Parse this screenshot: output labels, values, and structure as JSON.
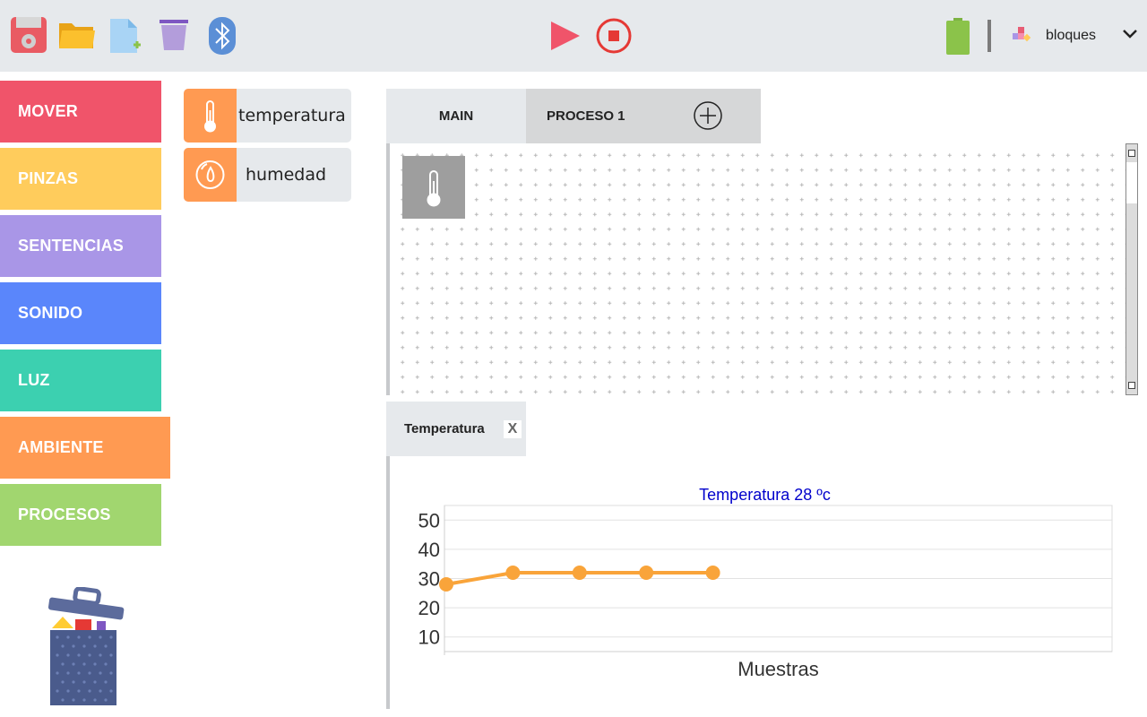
{
  "toolbar": {
    "icons": [
      "save-icon",
      "open-folder-icon",
      "new-file-icon",
      "trash-icon",
      "bluetooth-icon",
      "play-icon",
      "stop-icon",
      "battery-icon",
      "blocks-icon",
      "chevron-down-icon"
    ],
    "mode_label": "bloques"
  },
  "categories": [
    {
      "label": "MOVER",
      "color": "#f0546a"
    },
    {
      "label": "PINZAS",
      "color": "#ffcc5c"
    },
    {
      "label": "SENTENCIAS",
      "color": "#a996e7"
    },
    {
      "label": "SONIDO",
      "color": "#5a86fb"
    },
    {
      "label": "LUZ",
      "color": "#3cd0b0"
    },
    {
      "label": "AMBIENTE",
      "color": "#ff9a52"
    },
    {
      "label": "PROCESOS",
      "color": "#a1d66f"
    }
  ],
  "palette": {
    "items": [
      {
        "label": "temperatura",
        "icon": "thermometer-icon"
      },
      {
        "label": "humedad",
        "icon": "humidity-icon"
      }
    ]
  },
  "tabs": [
    {
      "label": "MAIN"
    },
    {
      "label": "PROCESO 1"
    }
  ],
  "chart_panel": {
    "tab_label": "Temperatura",
    "close_label": "X"
  },
  "chart_data": {
    "type": "line",
    "title": "Temperatura 28 ºc",
    "xlabel": "Muestras",
    "ylabel": "",
    "yticks": [
      10,
      20,
      30,
      40,
      50
    ],
    "x": [
      1,
      2,
      3,
      4,
      5
    ],
    "series": [
      {
        "values": [
          28,
          32,
          32,
          32,
          32
        ],
        "color": "#f9a43a"
      }
    ],
    "grid": true
  },
  "colors": {
    "accent_orange": "#ff9a52",
    "topbar_bg": "#e6e9ec"
  }
}
